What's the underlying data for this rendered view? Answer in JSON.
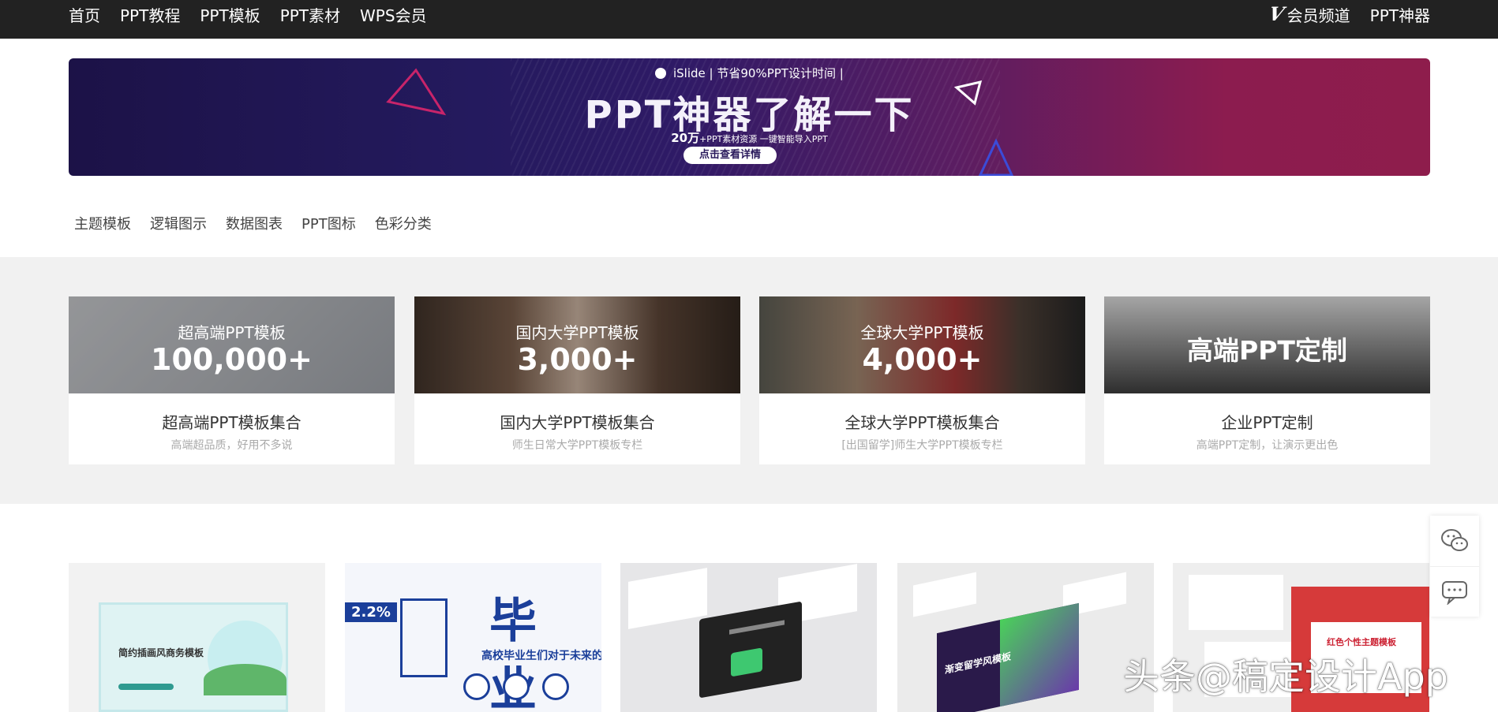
{
  "nav": {
    "left": [
      "首页",
      "PPT教程",
      "PPT模板",
      "PPT素材",
      "WPS会员"
    ],
    "vip_label": "会员频道",
    "tool_label": "PPT神器"
  },
  "banner": {
    "brand": "iSlide",
    "tagline": "节省90%PPT设计时间",
    "title": "PPT神器了解一下",
    "sub_count": "20万",
    "sub_text": "+PPT素材资源  一键智能导入PPT",
    "button": "点击查看详情"
  },
  "subcats": [
    "主题模板",
    "逻辑图示",
    "数据图表",
    "PPT图标",
    "色彩分类"
  ],
  "cards": [
    {
      "label": "超高端PPT模板",
      "number": "100,000+",
      "title": "超高端PPT模板集合",
      "subtitle": "高端超品质，好用不多说"
    },
    {
      "label": "国内大学PPT模板",
      "number": "3,000+",
      "title": "国内大学PPT模板集合",
      "subtitle": "师生日常大学PPT模板专栏"
    },
    {
      "label": "全球大学PPT模板",
      "number": "4,000+",
      "title": "全球大学PPT模板集合",
      "subtitle": "[出国留学]师生大学PPT模板专栏"
    },
    {
      "big": "高端PPT定制",
      "title": "企业PPT定制",
      "subtitle": "高端PPT定制，让演示更出色"
    }
  ],
  "templates": {
    "t1_title": "简约插画风商务模板",
    "t2_big": "毕业",
    "t2_pct": "2.2%",
    "t2_line": "高校毕业生们对于未来的职业",
    "t4_title": "渐变留学风模板",
    "t5_title": "红色个性主题模板"
  },
  "watermark": "头条@稿定设计App",
  "colors": {
    "nav_bg": "#222222",
    "gray_bg": "#f1f1f1",
    "accent_blue": "#1b3f9a"
  }
}
